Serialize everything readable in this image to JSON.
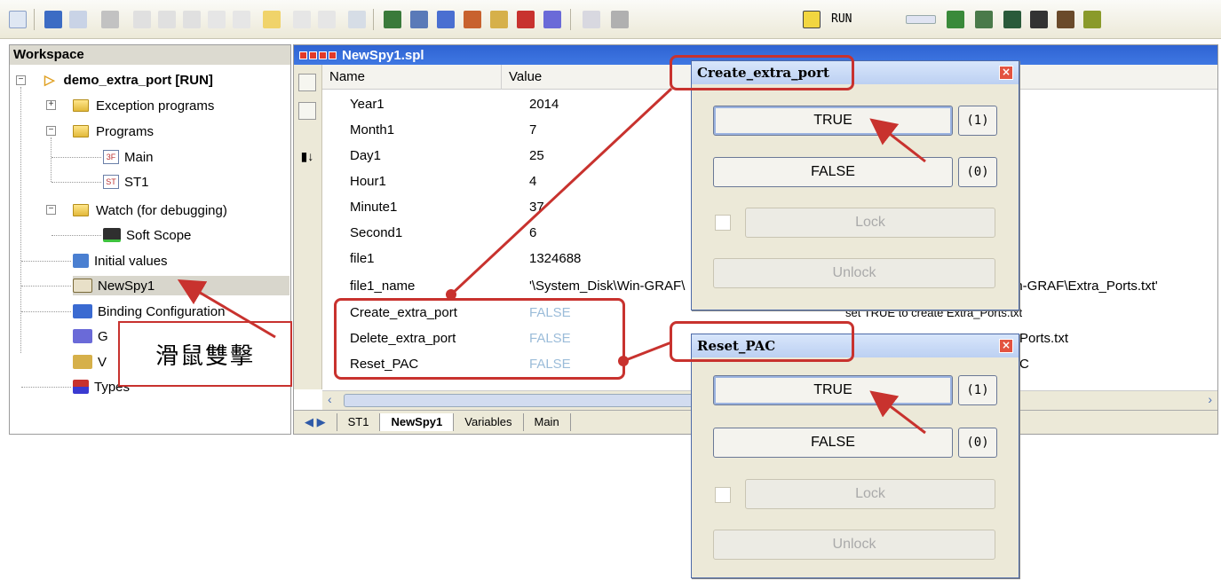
{
  "toolbar": {
    "run_label": "RUN",
    "icons": [
      "new-icon",
      "save-icon",
      "edit-icon",
      "print-icon",
      "cut-icon",
      "copy-icon",
      "paste-icon",
      "delete-icon",
      "find-icon",
      "undo-icon",
      "redo-icon",
      "grid-icon",
      "binding-icon",
      "spy-icon",
      "home-icon",
      "types-icon",
      "global-icon",
      "window-icon",
      "toggle-icon"
    ]
  },
  "workspace": {
    "title": "Workspace",
    "project": "demo_extra_port [RUN]",
    "tree": [
      {
        "label": "Exception programs"
      },
      {
        "label": "Programs"
      },
      {
        "label": "Main"
      },
      {
        "label": "ST1"
      },
      {
        "label": "Watch (for debugging)"
      },
      {
        "label": "Soft Scope"
      },
      {
        "label": "Initial values"
      },
      {
        "label": "NewSpy1"
      },
      {
        "label": "Binding Configuration"
      },
      {
        "label": "G"
      },
      {
        "label": "V"
      },
      {
        "label": "Types"
      }
    ]
  },
  "spy": {
    "title": "NewSpy1.spl",
    "col_name": "Name",
    "col_value": "Value",
    "rows": [
      {
        "name": "Year1",
        "value": "2014",
        "comment": ""
      },
      {
        "name": "Month1",
        "value": "7",
        "comment": ""
      },
      {
        "name": "Day1",
        "value": "25",
        "comment": ""
      },
      {
        "name": "Hour1",
        "value": "4",
        "comment": ""
      },
      {
        "name": "Minute1",
        "value": "37",
        "comment": ""
      },
      {
        "name": "Second1",
        "value": "6",
        "comment": ""
      },
      {
        "name": "file1",
        "value": "1324688",
        "comment": ""
      },
      {
        "name": "file1_name",
        "value": "'\\System_Disk\\Win-GRAF\\",
        "comment": "in-GRAF\\Extra_Ports.txt'"
      },
      {
        "name": "Create_extra_port",
        "value": "FALSE",
        "comment": "set TRUE to create Extra_Ports.txt"
      },
      {
        "name": "Delete_extra_port",
        "value": "FALSE",
        "comment": "Ports.txt"
      },
      {
        "name": "Reset_PAC",
        "value": "FALSE",
        "comment": "C"
      }
    ],
    "tabs": [
      "ST1",
      "NewSpy1",
      "Variables",
      "Main"
    ],
    "active_tab": "NewSpy1"
  },
  "dialogs": [
    {
      "title": "Create_extra_port",
      "true_label": "TRUE",
      "true_value": "(1)",
      "false_label": "FALSE",
      "false_value": "(0)",
      "lock_label": "Lock",
      "unlock_label": "Unlock"
    },
    {
      "title": "Reset_PAC",
      "true_label": "TRUE",
      "true_value": "(1)",
      "false_label": "FALSE",
      "false_value": "(0)",
      "lock_label": "Lock",
      "unlock_label": "Unlock"
    }
  ],
  "annotation": {
    "callout_text": "滑鼠雙擊",
    "accent_color": "#c8322e"
  }
}
